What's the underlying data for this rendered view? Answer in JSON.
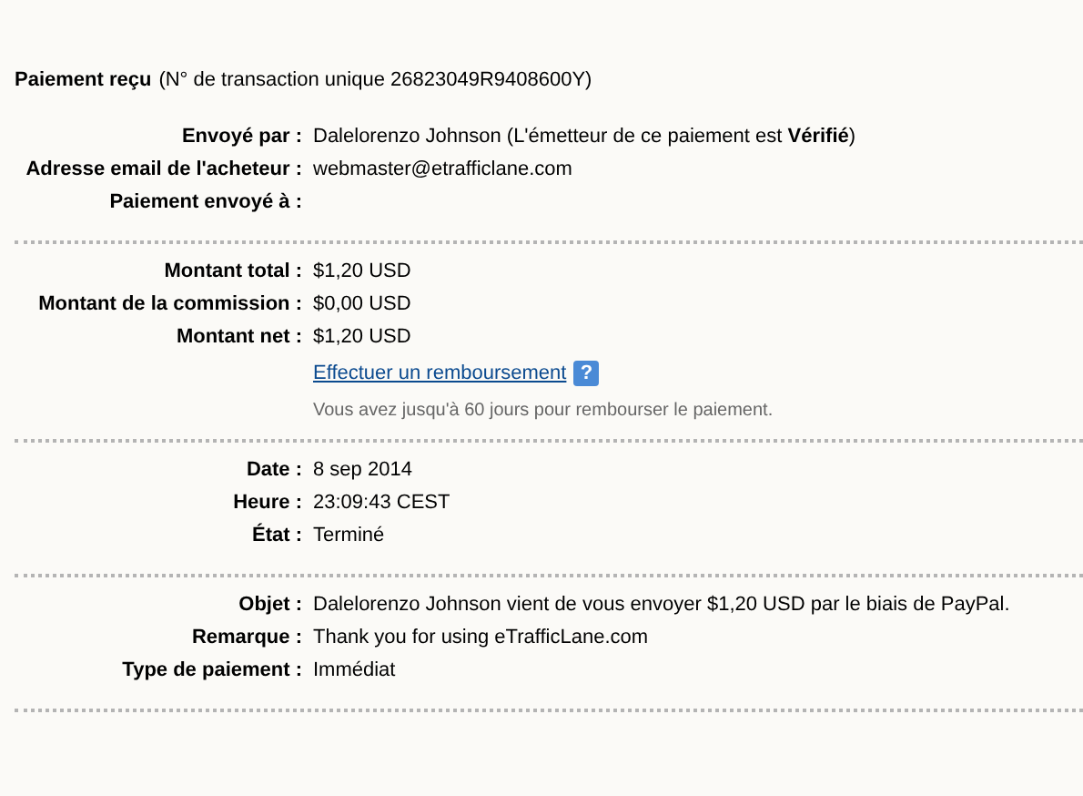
{
  "header": {
    "title": "Paiement reçu",
    "transaction": "(N° de transaction unique 26823049R9408600Y)"
  },
  "sections": [
    {
      "rows": [
        {
          "label": "Envoyé par :",
          "value": "Dalelorenzo Johnson (L'émetteur de ce paiement est **Vérifié**)"
        },
        {
          "label": "Adresse email de l'acheteur :",
          "value": "webmaster@etrafficlane.com"
        },
        {
          "label": "Paiement envoyé à :"
        }
      ]
    },
    {
      "rows": [
        {
          "label": "Montant total :",
          "value": "$1,20 USD"
        },
        {
          "label": "Montant de la commission :",
          "value": "$0,00 USD"
        },
        {
          "label": "Montant net :",
          "value": "$1,20 USD"
        }
      ],
      "refund": {
        "link": "Effectuer un remboursement",
        "help": "?",
        "note": "Vous avez jusqu'à 60 jours pour rembourser le paiement."
      }
    },
    {
      "rows": [
        {
          "label": "Date :",
          "value": "8 sep 2014"
        },
        {
          "label": "Heure :",
          "value": "23:09:43 CEST"
        },
        {
          "label": "État :",
          "value": "Terminé"
        }
      ]
    },
    {
      "rows": [
        {
          "label": "Objet :",
          "value": "Dalelorenzo Johnson vient de vous envoyer $1,20 USD par le biais de PayPal."
        },
        {
          "label": "Remarque :",
          "value": "Thank you for using eTrafficLane.com"
        },
        {
          "label": "Type de paiement :",
          "value": "Immédiat"
        }
      ]
    }
  ]
}
